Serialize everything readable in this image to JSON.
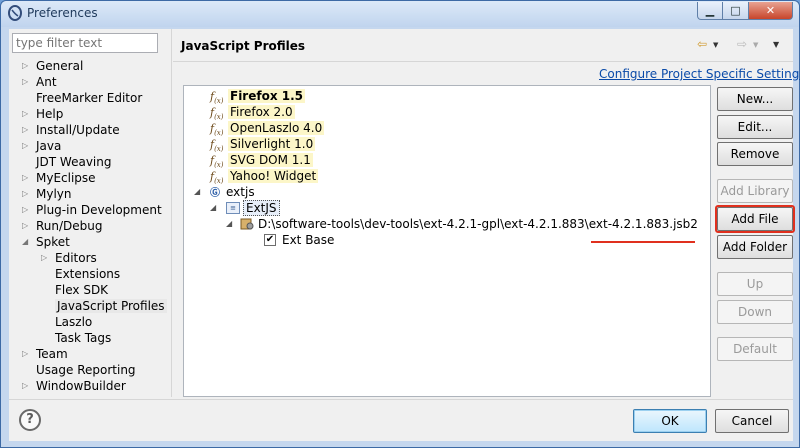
{
  "window": {
    "title": "Preferences",
    "controls": {
      "minimize": "▁",
      "maximize": "□",
      "close": "✕"
    }
  },
  "sidebar": {
    "filter_placeholder": "type filter text",
    "items": [
      {
        "label": "General",
        "expandable": true
      },
      {
        "label": "Ant",
        "expandable": true
      },
      {
        "label": "FreeMarker Editor",
        "expandable": false
      },
      {
        "label": "Help",
        "expandable": true
      },
      {
        "label": "Install/Update",
        "expandable": true
      },
      {
        "label": "Java",
        "expandable": true
      },
      {
        "label": "JDT Weaving",
        "expandable": false
      },
      {
        "label": "MyEclipse",
        "expandable": true
      },
      {
        "label": "Mylyn",
        "expandable": true
      },
      {
        "label": "Plug-in Development",
        "expandable": true
      },
      {
        "label": "Run/Debug",
        "expandable": true
      },
      {
        "label": "Spket",
        "expandable": true,
        "expanded": true
      },
      {
        "label": "Editors",
        "expandable": true,
        "child": true
      },
      {
        "label": "Extensions",
        "child": true
      },
      {
        "label": "Flex SDK",
        "child": true
      },
      {
        "label": "JavaScript Profiles",
        "child": true,
        "selected": true
      },
      {
        "label": "Laszlo",
        "child": true
      },
      {
        "label": "Task Tags",
        "child": true
      },
      {
        "label": "Team",
        "expandable": true
      },
      {
        "label": "Usage Reporting",
        "expandable": false
      },
      {
        "label": "WindowBuilder",
        "expandable": true
      }
    ]
  },
  "main": {
    "title": "JavaScript Profiles",
    "configure_link": "Configure Project Specific Settings...",
    "nav_icons": [
      "back-arrow-icon",
      "forward-arrow-icon",
      "menu-dropdown-icon"
    ],
    "profiles": [
      {
        "label": "Firefox 1.5",
        "bold": true,
        "icon": "fx-icon"
      },
      {
        "label": "Firefox 2.0",
        "icon": "fx-icon"
      },
      {
        "label": "OpenLaszlo 4.0",
        "icon": "fx-icon"
      },
      {
        "label": "Silverlight 1.0",
        "icon": "fx-icon"
      },
      {
        "label": "SVG DOM 1.1",
        "icon": "fx-icon"
      },
      {
        "label": "Yahoo! Widget",
        "icon": "fx-icon"
      }
    ],
    "extjs_profile": {
      "label": "extjs",
      "library": "ExtJS",
      "file_path": "D:\\software-tools\\dev-tools\\ext-4.2.1-gpl\\ext-4.2.1.883\\ext-4.2.1.883.jsb2",
      "module": "Ext Base",
      "module_checked": true
    },
    "buttons": {
      "new": "New...",
      "edit": "Edit...",
      "remove": "Remove",
      "add_library": "Add Library",
      "add_file": "Add File",
      "add_folder": "Add Folder",
      "up": "Up",
      "down": "Down",
      "default": "Default"
    }
  },
  "footer": {
    "help": "?",
    "ok": "OK",
    "cancel": "Cancel"
  },
  "colors": {
    "highlight": "#fcf6c8",
    "link": "#0a4aa8",
    "annotation_red": "#e0301e"
  }
}
